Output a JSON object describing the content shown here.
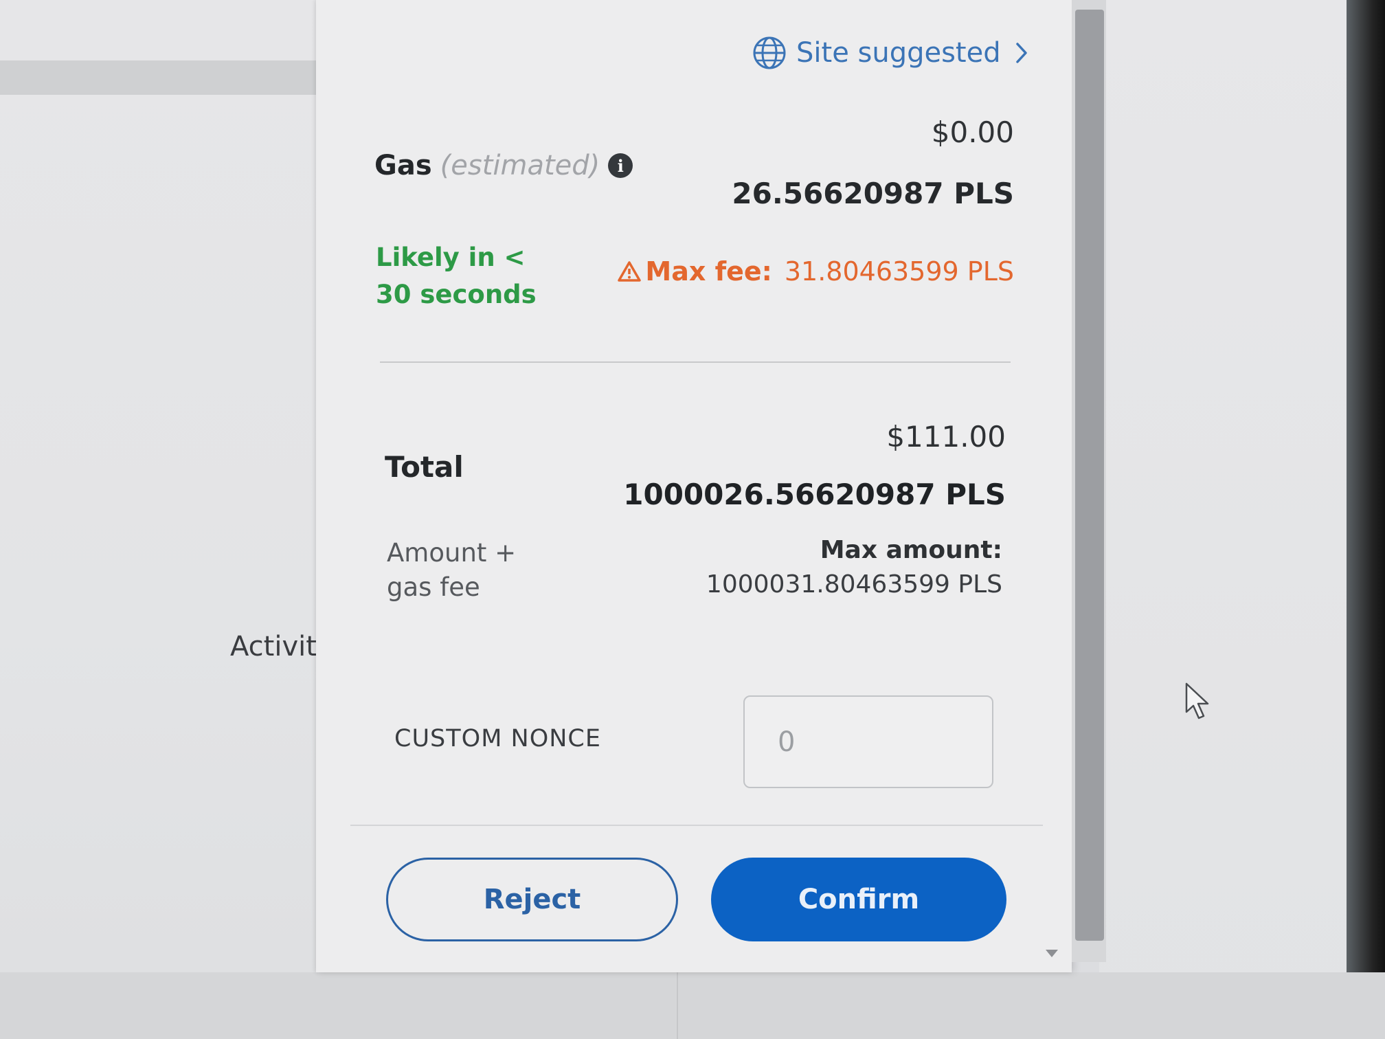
{
  "background": {
    "activity_label": "Activity"
  },
  "header": {
    "site_suggested_label": "Site suggested",
    "globe_icon": "globe-icon",
    "chevron_icon": "chevron-right-icon"
  },
  "gas": {
    "label": "Gas",
    "estimated_label": "(estimated)",
    "info_icon": "info-icon",
    "fiat": "$0.00",
    "native": "26.56620987 PLS",
    "likely_text": "Likely in < 30 seconds",
    "max_fee_label": "Max fee:",
    "max_fee_value": "31.80463599 PLS",
    "warning_icon": "warning-icon"
  },
  "total": {
    "label": "Total",
    "fiat": "$111.00",
    "native": "1000026.56620987 PLS",
    "sublabel": "Amount + gas fee",
    "max_amount_label": "Max amount:",
    "max_amount_value": "1000031.80463599 PLS"
  },
  "nonce": {
    "label": "CUSTOM NONCE",
    "placeholder": "0"
  },
  "actions": {
    "reject_label": "Reject",
    "confirm_label": "Confirm"
  },
  "colors": {
    "link_blue": "#3b74b6",
    "confirm_blue": "#0c62c4",
    "success_green": "#2d9a46",
    "warning_orange": "#e3672e"
  }
}
